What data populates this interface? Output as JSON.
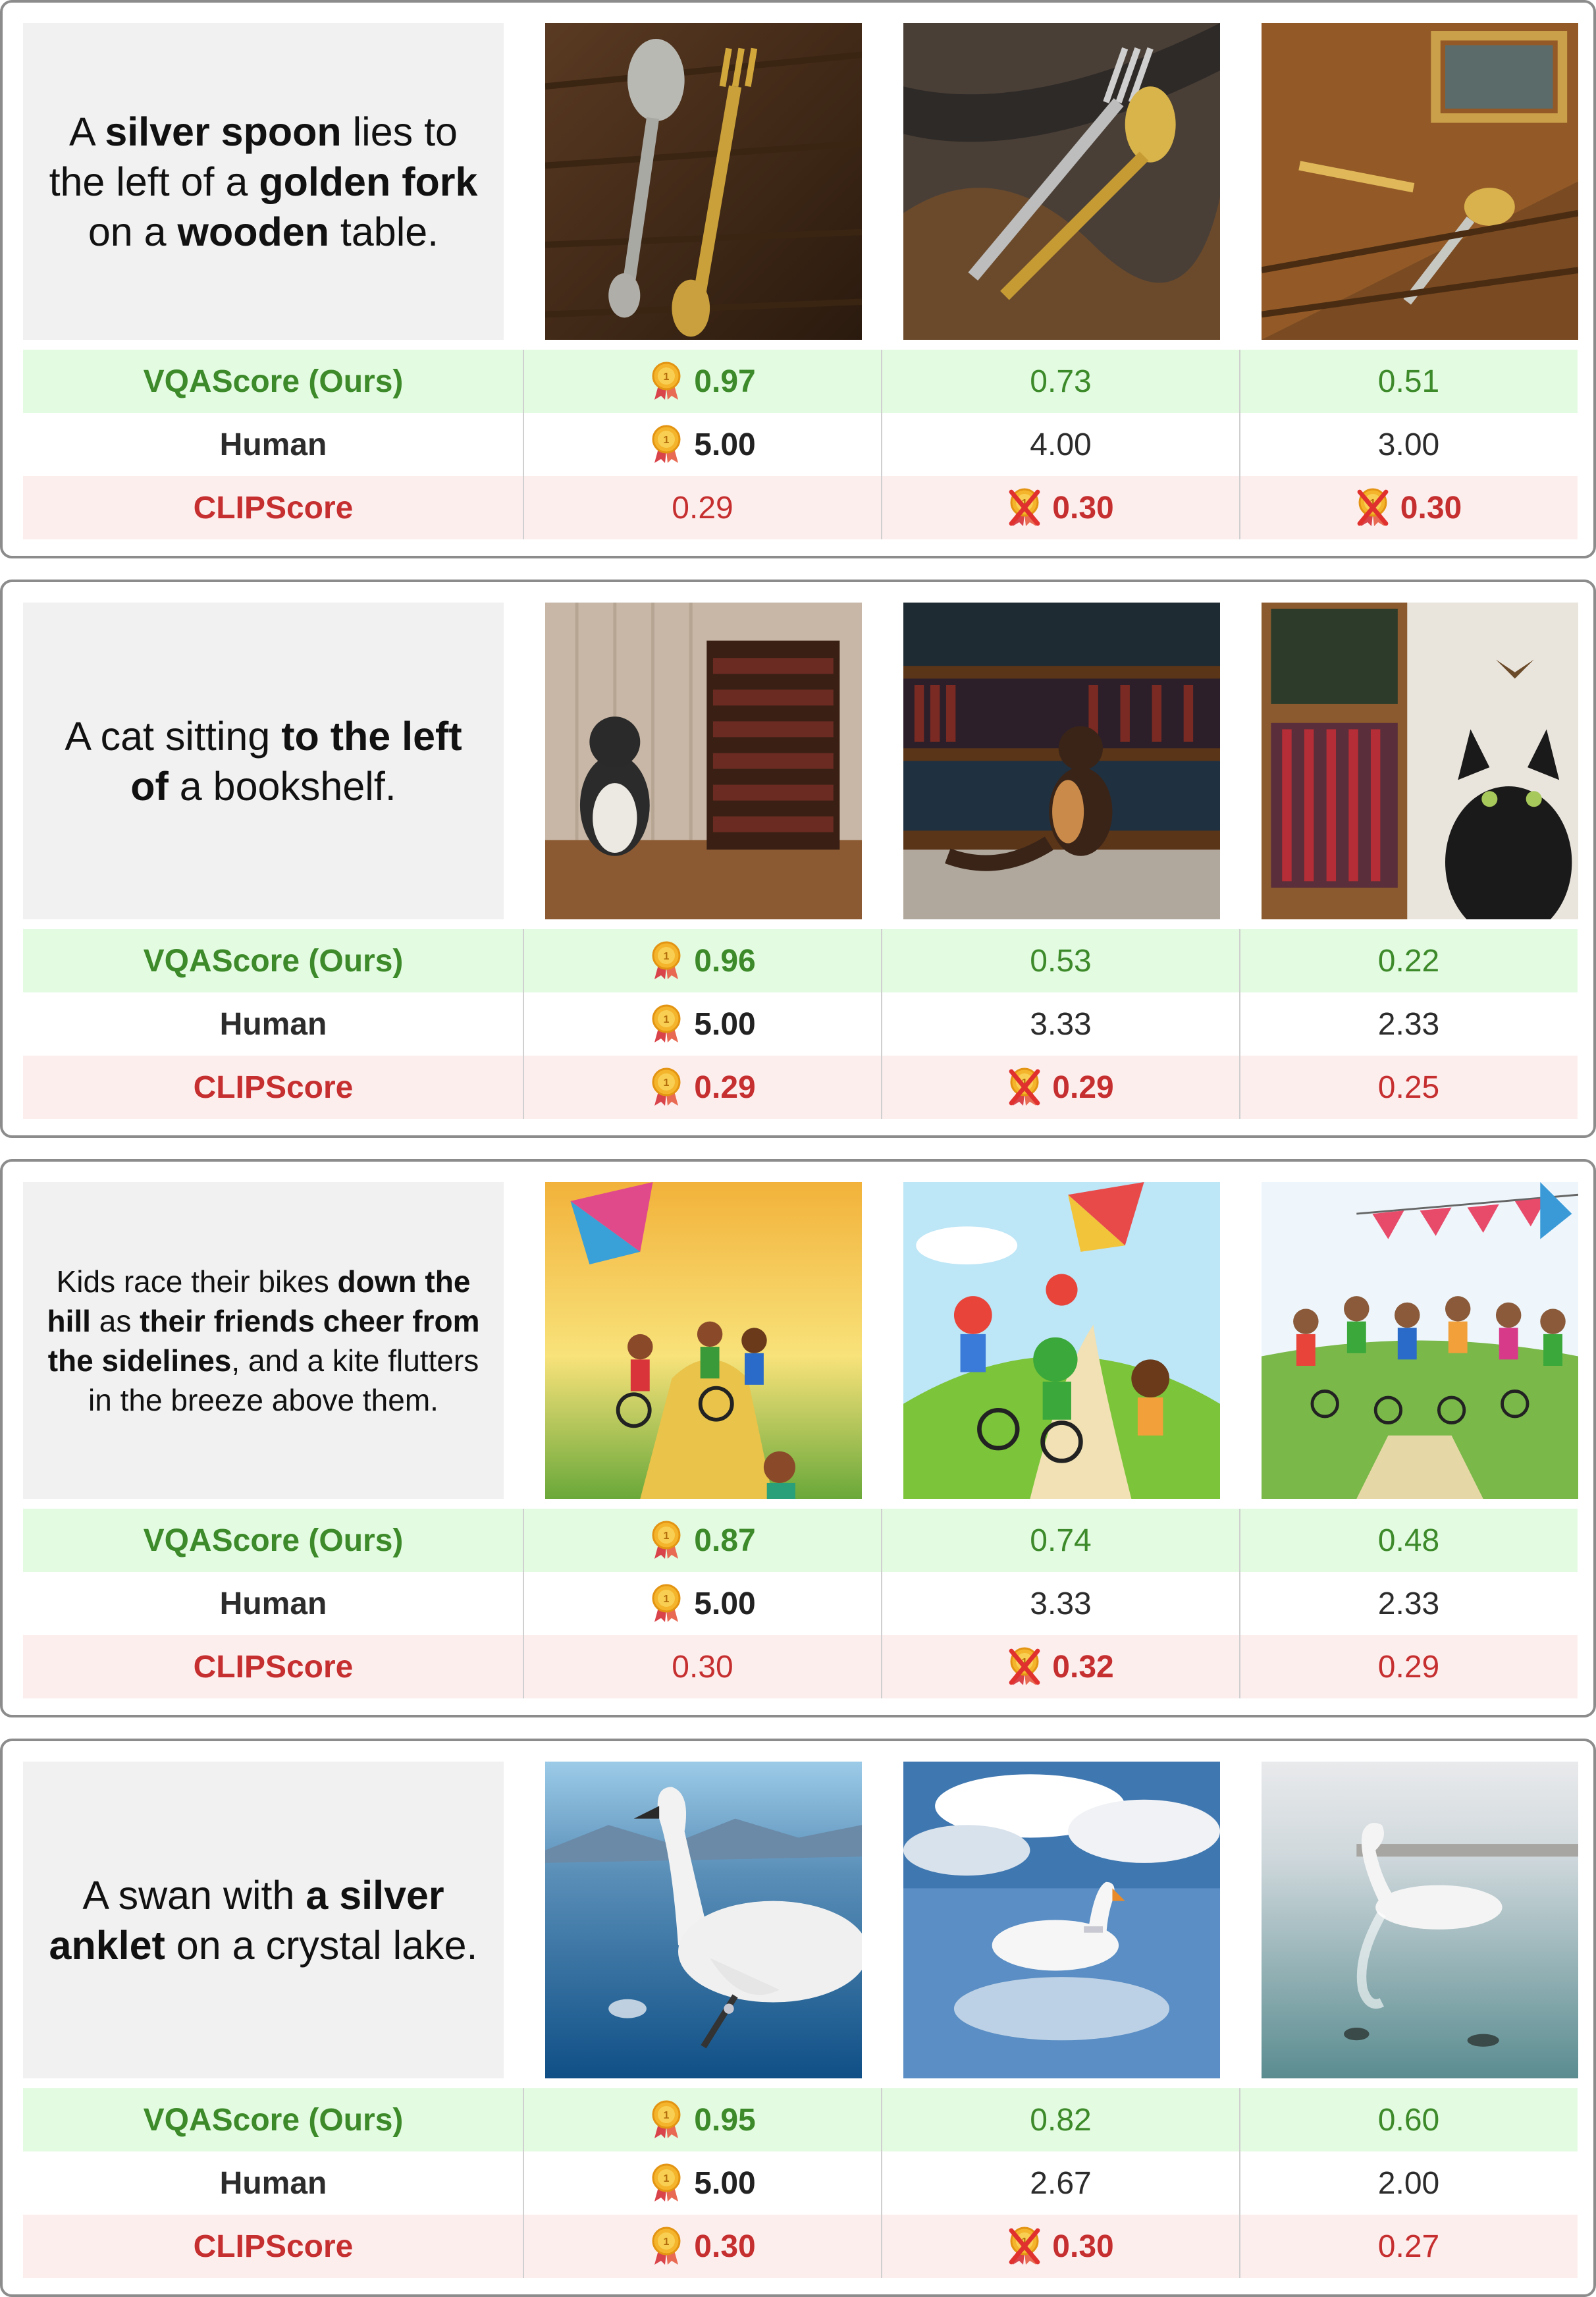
{
  "colors": {
    "vqascore": "#3d8a2a",
    "human": "#2c2c2c",
    "clipscore": "#c62f2f",
    "vqascore_row_bg": "#e3fbe1",
    "clipscore_row_bg": "#fdeeee",
    "prompt_bg": "#f1f1f1"
  },
  "row_labels": {
    "vqascore": "VQAScore (Ours)",
    "human": "Human",
    "clipscore": "CLIPScore"
  },
  "examples": [
    {
      "prompt": {
        "runs": [
          {
            "t": "A ",
            "b": false
          },
          {
            "t": "silver spoon",
            "b": true
          },
          {
            "t": " lies to the left of a ",
            "b": false
          },
          {
            "t": "golden fork",
            "b": true
          },
          {
            "t": " on a ",
            "b": false
          },
          {
            "t": "wooden",
            "b": true
          },
          {
            "t": " table.",
            "b": false
          }
        ]
      },
      "images": [
        "spoon-fork-image",
        "spoon-fork-image",
        "spoon-fork-image"
      ],
      "scores": {
        "vqascore": [
          {
            "value": "0.97",
            "best": true,
            "icon": "medal-icon"
          },
          {
            "value": "0.73",
            "best": false,
            "icon": ""
          },
          {
            "value": "0.51",
            "best": false,
            "icon": ""
          }
        ],
        "human": [
          {
            "value": "5.00",
            "best": true,
            "icon": "medal-icon"
          },
          {
            "value": "4.00",
            "best": false,
            "icon": ""
          },
          {
            "value": "3.00",
            "best": false,
            "icon": ""
          }
        ],
        "clipscore": [
          {
            "value": "0.29",
            "best": false,
            "icon": ""
          },
          {
            "value": "0.30",
            "best": true,
            "icon": "crossed-medal-icon"
          },
          {
            "value": "0.30",
            "best": true,
            "icon": "crossed-medal-icon"
          }
        ]
      }
    },
    {
      "prompt": {
        "runs": [
          {
            "t": "A cat sitting ",
            "b": false
          },
          {
            "t": "to the left of",
            "b": true
          },
          {
            "t": " a bookshelf.",
            "b": false
          }
        ]
      },
      "images": [
        "cat-bookshelf-image",
        "cat-bookshelf-image",
        "cat-bookshelf-image"
      ],
      "scores": {
        "vqascore": [
          {
            "value": "0.96",
            "best": true,
            "icon": "medal-icon"
          },
          {
            "value": "0.53",
            "best": false,
            "icon": ""
          },
          {
            "value": "0.22",
            "best": false,
            "icon": ""
          }
        ],
        "human": [
          {
            "value": "5.00",
            "best": true,
            "icon": "medal-icon"
          },
          {
            "value": "3.33",
            "best": false,
            "icon": ""
          },
          {
            "value": "2.33",
            "best": false,
            "icon": ""
          }
        ],
        "clipscore": [
          {
            "value": "0.29",
            "best": true,
            "icon": "medal-icon"
          },
          {
            "value": "0.29",
            "best": true,
            "icon": "crossed-medal-icon"
          },
          {
            "value": "0.25",
            "best": false,
            "icon": ""
          }
        ]
      }
    },
    {
      "prompt": {
        "small": true,
        "runs": [
          {
            "t": "Kids race their bikes ",
            "b": false
          },
          {
            "t": "down the hill",
            "b": true
          },
          {
            "t": " as ",
            "b": false
          },
          {
            "t": "their friends cheer from the sidelines",
            "b": true
          },
          {
            "t": ", and a kite flutters in the breeze above them.",
            "b": false
          }
        ]
      },
      "images": [
        "kids-bikes-kite-image",
        "kids-bikes-kite-image",
        "kids-bikes-kite-image"
      ],
      "scores": {
        "vqascore": [
          {
            "value": "0.87",
            "best": true,
            "icon": "medal-icon"
          },
          {
            "value": "0.74",
            "best": false,
            "icon": ""
          },
          {
            "value": "0.48",
            "best": false,
            "icon": ""
          }
        ],
        "human": [
          {
            "value": "5.00",
            "best": true,
            "icon": "medal-icon"
          },
          {
            "value": "3.33",
            "best": false,
            "icon": ""
          },
          {
            "value": "2.33",
            "best": false,
            "icon": ""
          }
        ],
        "clipscore": [
          {
            "value": "0.30",
            "best": false,
            "icon": ""
          },
          {
            "value": "0.32",
            "best": true,
            "icon": "crossed-medal-icon"
          },
          {
            "value": "0.29",
            "best": false,
            "icon": ""
          }
        ]
      }
    },
    {
      "prompt": {
        "runs": [
          {
            "t": "A swan with ",
            "b": false
          },
          {
            "t": "a silver anklet",
            "b": true
          },
          {
            "t": " on a crystal lake.",
            "b": false
          }
        ]
      },
      "images": [
        "swan-lake-image",
        "swan-lake-image",
        "swan-lake-image"
      ],
      "scores": {
        "vqascore": [
          {
            "value": "0.95",
            "best": true,
            "icon": "medal-icon"
          },
          {
            "value": "0.82",
            "best": false,
            "icon": ""
          },
          {
            "value": "0.60",
            "best": false,
            "icon": ""
          }
        ],
        "human": [
          {
            "value": "5.00",
            "best": true,
            "icon": "medal-icon"
          },
          {
            "value": "2.67",
            "best": false,
            "icon": ""
          },
          {
            "value": "2.00",
            "best": false,
            "icon": ""
          }
        ],
        "clipscore": [
          {
            "value": "0.30",
            "best": true,
            "icon": "medal-icon"
          },
          {
            "value": "0.30",
            "best": true,
            "icon": "crossed-medal-icon"
          },
          {
            "value": "0.27",
            "best": false,
            "icon": ""
          }
        ]
      }
    }
  ]
}
